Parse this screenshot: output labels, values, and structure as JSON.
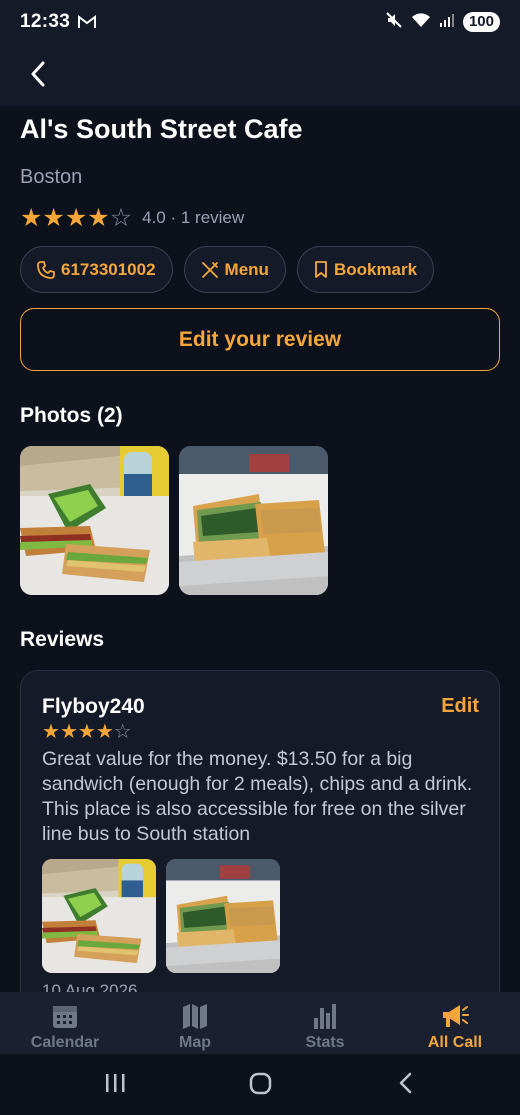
{
  "status_bar": {
    "time": "12:33",
    "battery": "100"
  },
  "place": {
    "name": "Al's South Street Cafe",
    "city": "Boston",
    "rating": 4,
    "rating_text": "4.0 · 1 review"
  },
  "actions": {
    "phone": "6173301002",
    "menu": "Menu",
    "bookmark": "Bookmark"
  },
  "edit_review_label": "Edit your review",
  "photos": {
    "title": "Photos (2)"
  },
  "reviews": {
    "title": "Reviews",
    "items": [
      {
        "author": "Flyboy240",
        "edit_label": "Edit",
        "rating": 4,
        "text": "Great value for the money. $13.50 for a big sandwich (enough for 2 meals), chips and a drink. This place is also accessible for free on the silver line bus to South station",
        "date": "10 Aug 2026"
      }
    ]
  },
  "bottom_nav": [
    {
      "label": "Calendar",
      "icon": "calendar-icon",
      "active": false
    },
    {
      "label": "Map",
      "icon": "map-icon",
      "active": false
    },
    {
      "label": "Stats",
      "icon": "stats-icon",
      "active": false
    },
    {
      "label": "All Call",
      "icon": "megaphone-icon",
      "active": true
    }
  ],
  "colors": {
    "accent": "#f5a63a",
    "background": "#0d111c",
    "card": "#151a29"
  }
}
